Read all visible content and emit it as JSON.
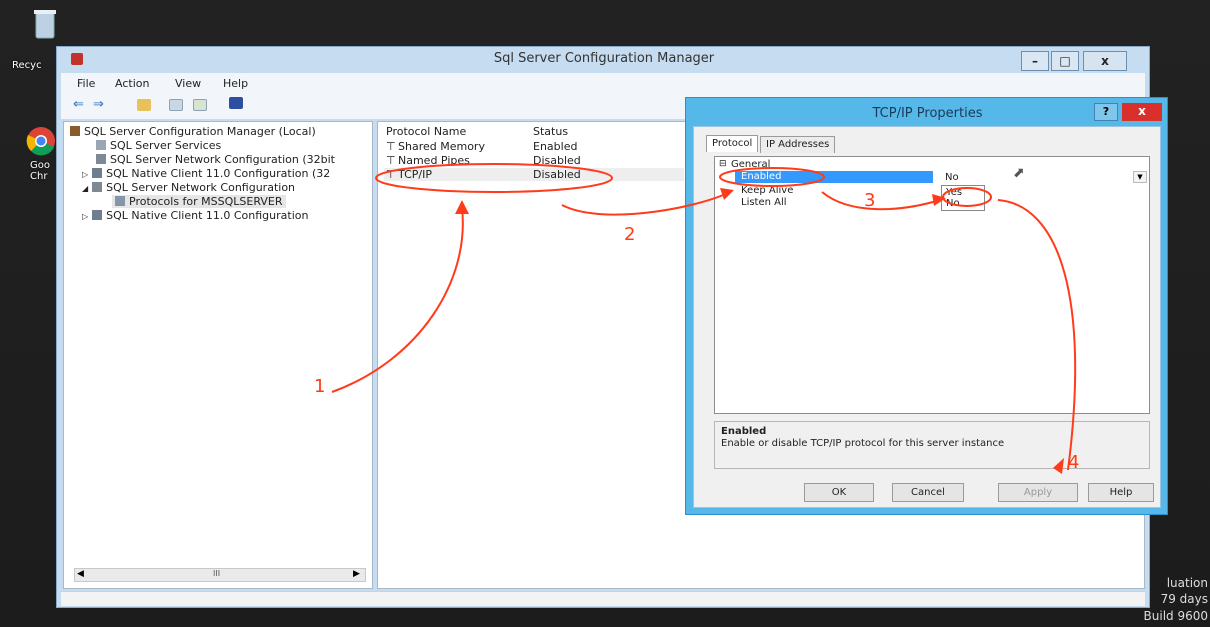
{
  "desktop": {
    "icons": [
      {
        "label": "Recyc",
        "icon": "recycle-bin-icon"
      },
      {
        "label": "Goo Chr",
        "icon": "chrome-icon"
      }
    ],
    "watermark": [
      "luation",
      "79 days",
      "Build 9600"
    ]
  },
  "main_window": {
    "title": "Sql Server Configuration Manager",
    "controls": [
      "–",
      "□",
      "x"
    ],
    "menu": [
      "File",
      "Action",
      "View",
      "Help"
    ],
    "tree": [
      {
        "label": "SQL Server Configuration Manager (Local)",
        "icon": "server-config-icon"
      },
      {
        "label": "SQL Server Services",
        "icon": "services-icon"
      },
      {
        "label": "SQL Server Network Configuration (32bit",
        "icon": "network-config-icon"
      },
      {
        "label": "SQL Native Client 11.0 Configuration (32",
        "icon": "native-client-icon"
      },
      {
        "label": "SQL Server Network Configuration",
        "icon": "network-config-icon"
      },
      {
        "label": "Protocols for MSSQLSERVER",
        "icon": "protocols-icon"
      },
      {
        "label": "SQL Native Client 11.0 Configuration",
        "icon": "native-client-icon"
      }
    ],
    "list_columns": [
      "Protocol Name",
      "Status"
    ],
    "list_rows": [
      {
        "name": "Shared Memory",
        "status": "Enabled"
      },
      {
        "name": "Named Pipes",
        "status": "Disabled"
      },
      {
        "name": "TCP/IP",
        "status": "Disabled"
      }
    ],
    "scroll_thumb": "III"
  },
  "dialog": {
    "title": "TCP/IP Properties",
    "help_btn": "?",
    "close_btn": "x",
    "tabs": [
      "Protocol",
      "IP Addresses"
    ],
    "group": "General",
    "props": [
      {
        "name": "Enabled",
        "value": "No"
      },
      {
        "name": "Keep Alive",
        "value": ""
      },
      {
        "name": "Listen All",
        "value": ""
      }
    ],
    "dropdown_options": [
      "Yes",
      "No"
    ],
    "desc_title": "Enabled",
    "desc_text": "Enable or disable TCP/IP protocol for this server instance",
    "buttons": {
      "ok": "OK",
      "cancel": "Cancel",
      "apply": "Apply",
      "help": "Help"
    }
  },
  "annotations": {
    "step1": "1",
    "step2": "2",
    "step3": "3",
    "step4": "4"
  },
  "colors": {
    "annotation": "#ff3b1a",
    "dialog_frame": "#55b8e8",
    "close": "#d9302c",
    "selection": "#3399ff"
  }
}
